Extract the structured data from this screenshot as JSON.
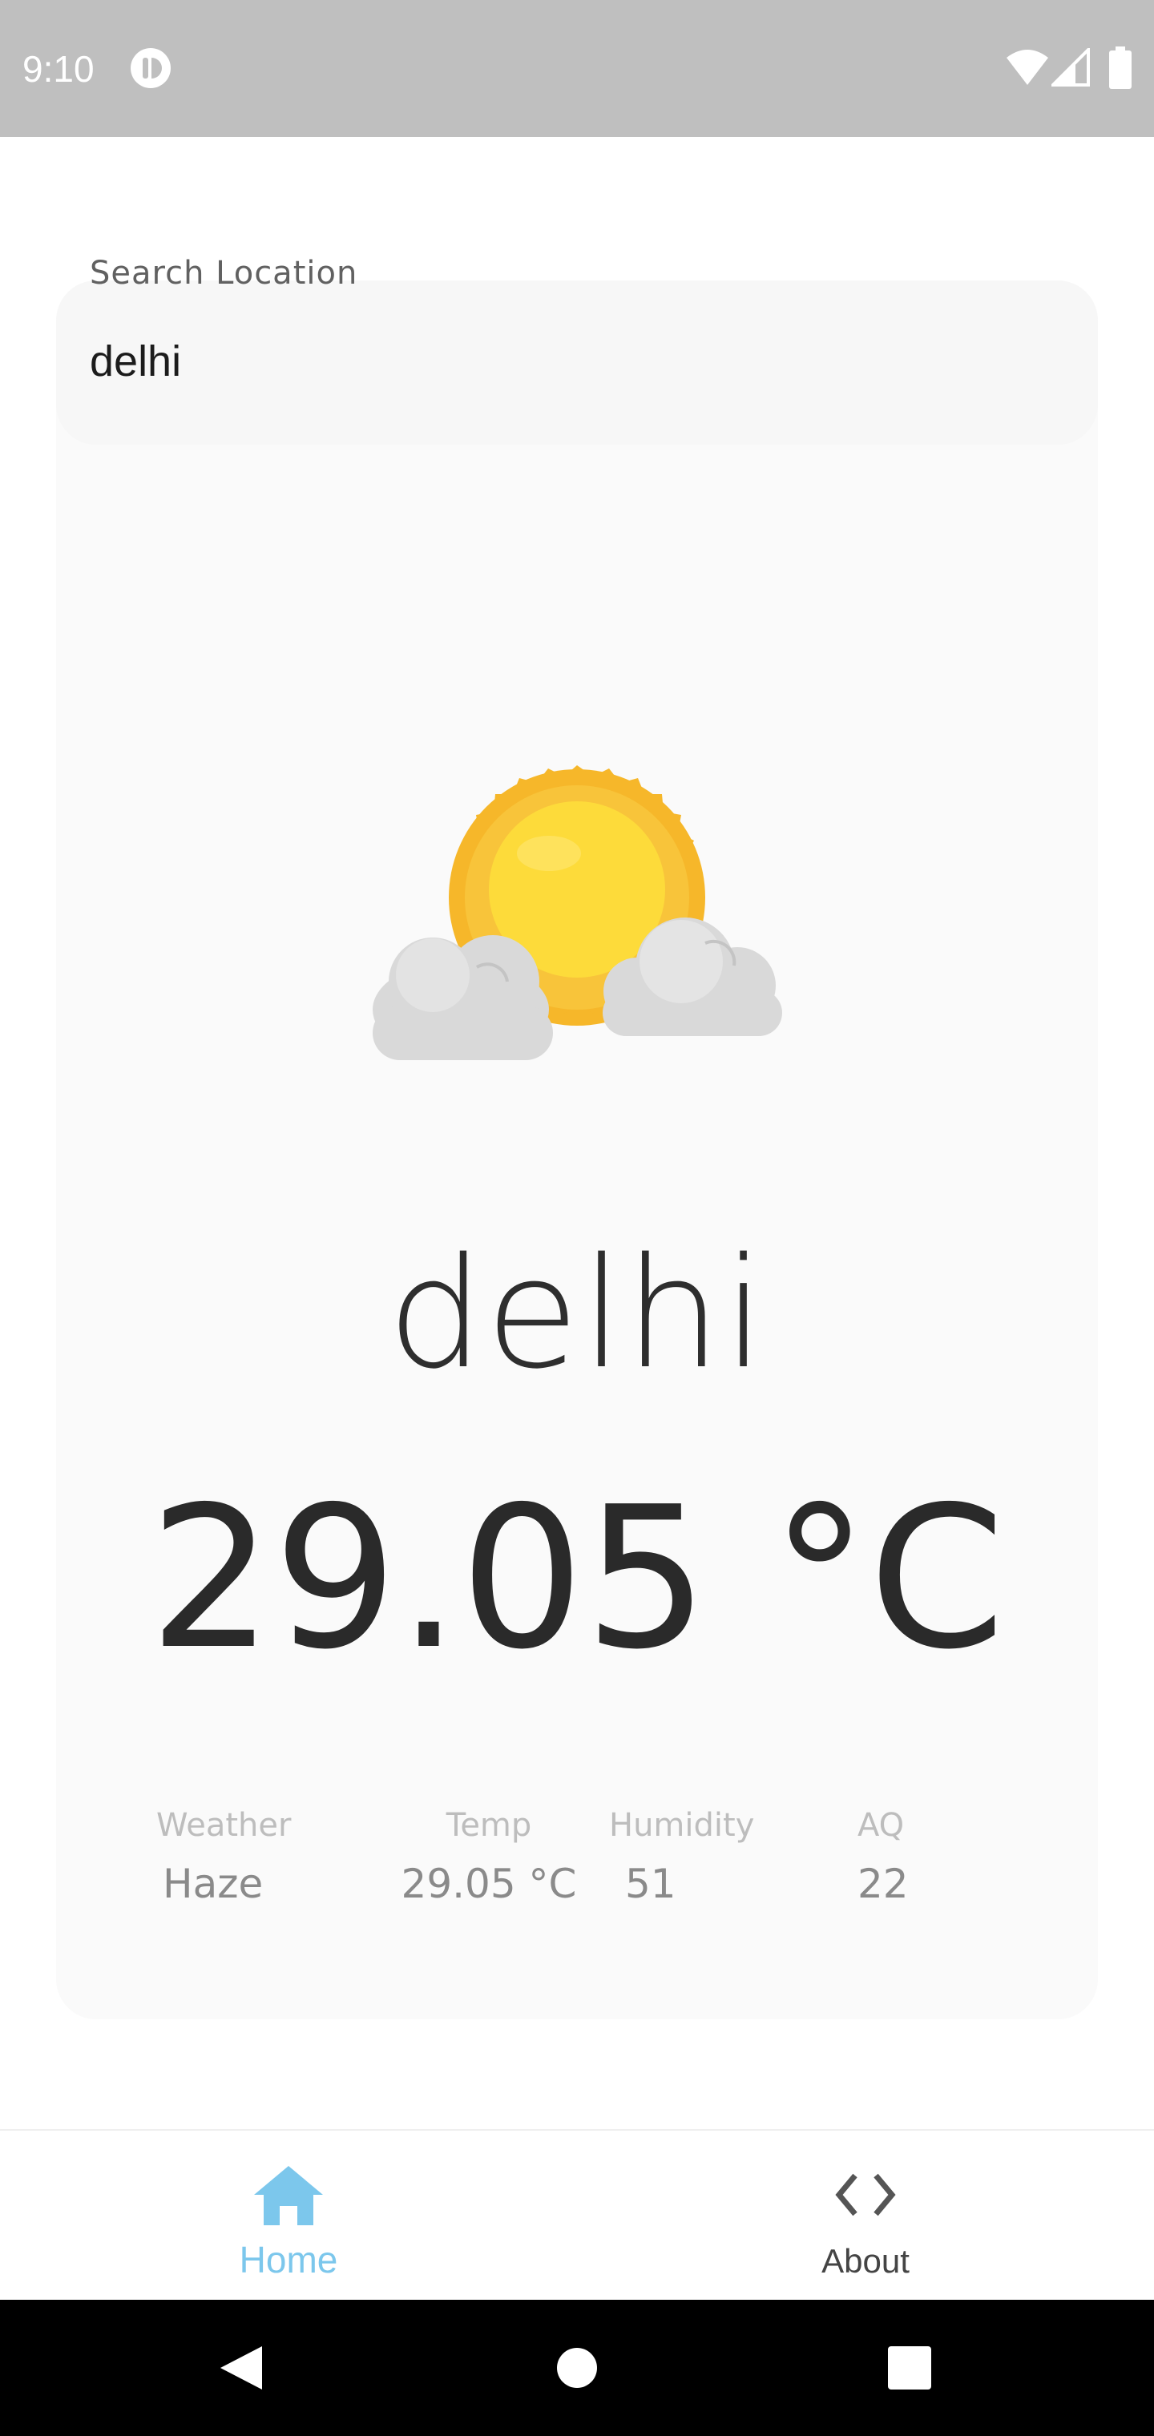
{
  "status_bar": {
    "time": "9:10",
    "icons": [
      "app-notification-icon",
      "wifi-icon",
      "signal-icon",
      "battery-icon"
    ]
  },
  "search": {
    "label": "Search Location",
    "value": "delhi"
  },
  "weather": {
    "icon": "partly-cloudy-sun-icon",
    "city": "delhi",
    "temperature": "29.05 °C",
    "stats": [
      {
        "label": "Weather",
        "value": "Haze"
      },
      {
        "label": "Temp",
        "value": "29.05 °C"
      },
      {
        "label": "Humidity",
        "value": "51"
      },
      {
        "label": "AQ",
        "value": "22"
      }
    ]
  },
  "bottom_nav": {
    "items": [
      {
        "label": "Home",
        "icon": "home-icon",
        "active": true
      },
      {
        "label": "About",
        "icon": "code-icon",
        "active": false
      }
    ],
    "active_color": "#7cc7ec"
  },
  "system_nav": {
    "buttons": [
      "back-icon",
      "home-circle-icon",
      "recents-icon"
    ]
  }
}
